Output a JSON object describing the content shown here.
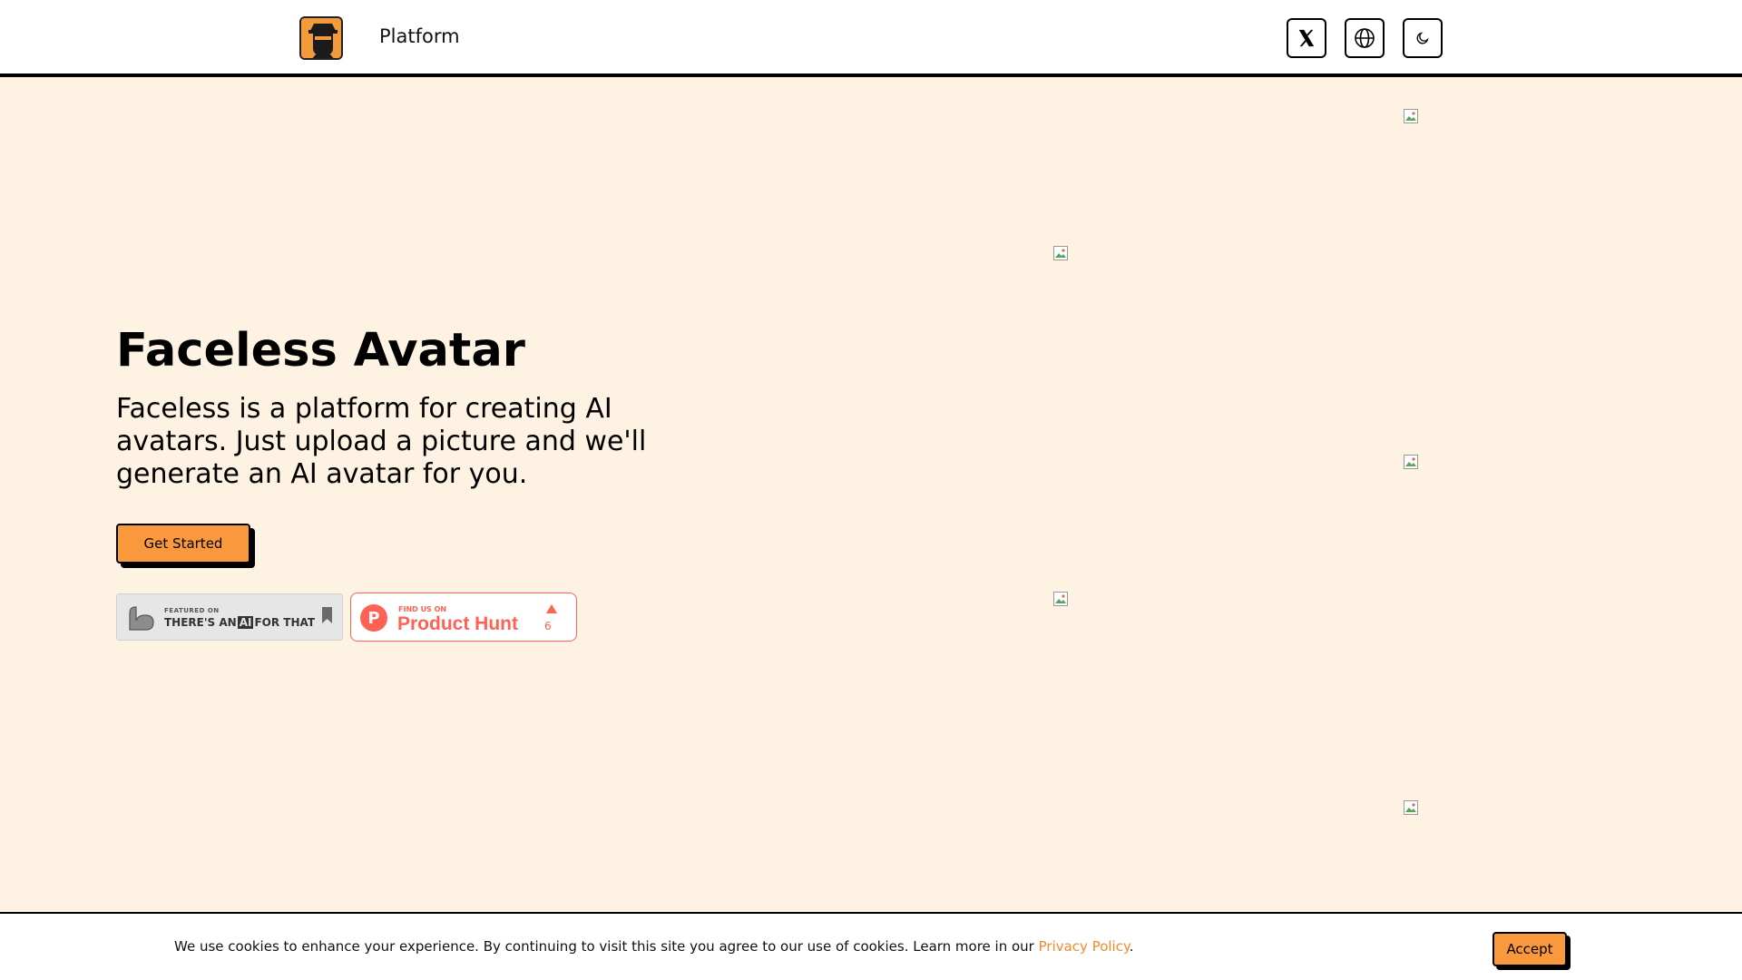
{
  "header": {
    "nav_link": "Platform",
    "icons": [
      "logo",
      "x-icon",
      "globe-icon",
      "moon-icon"
    ]
  },
  "hero": {
    "title": "Faceless Avatar",
    "description": "Faceless is a platform for creating AI avatars. Just upload a picture and we'll generate an AI avatar for you.",
    "cta_label": "Get Started"
  },
  "badges": {
    "taaft": {
      "featured": "FEATURED ON",
      "name_part1": "THERE'S AN",
      "name_ai": "AI",
      "name_part2": "FOR THAT"
    },
    "product_hunt": {
      "find_us": "FIND US ON",
      "name": "Product Hunt",
      "votes": "6"
    }
  },
  "cookie": {
    "text": "We use cookies to enhance your experience. By continuing to visit this site you agree to our use of cookies. Learn more in our ",
    "link": "Privacy Policy",
    "suffix": ".",
    "accept_label": "Accept"
  },
  "colors": {
    "accent": "#f9983d",
    "background": "#fef3e2",
    "product_hunt": "#ff6154"
  }
}
